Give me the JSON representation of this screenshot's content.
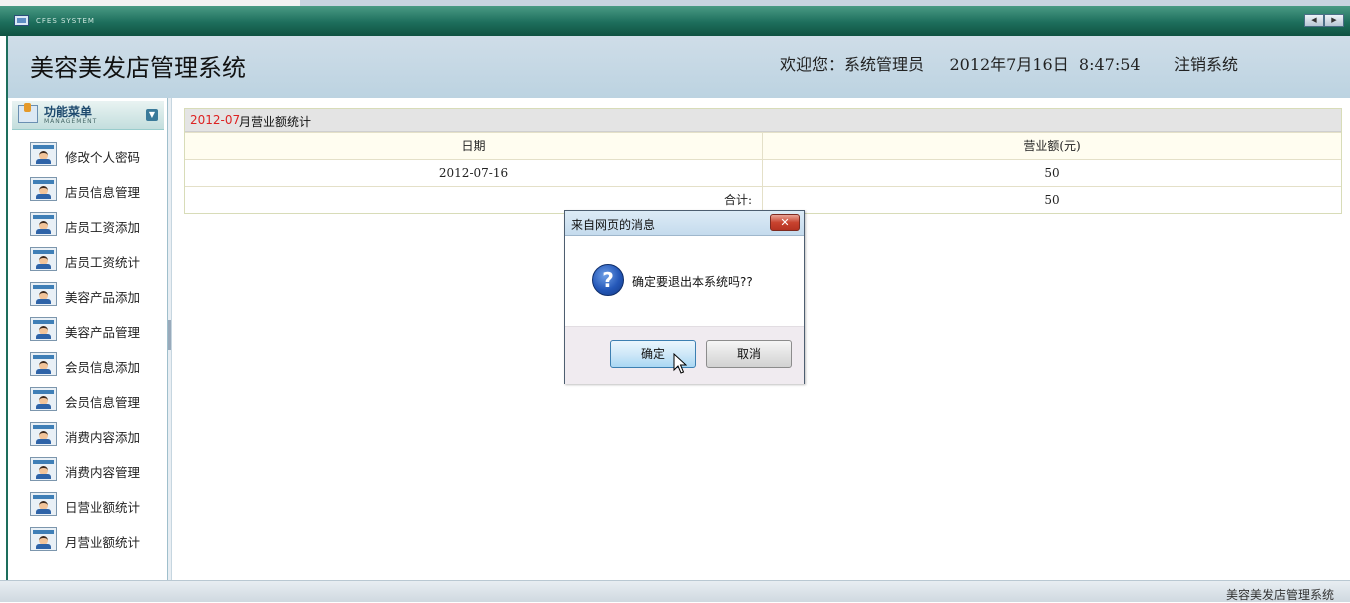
{
  "system_bar": {
    "title": "CFES SYSTEM"
  },
  "header": {
    "app_title": "美容美发店管理系统",
    "welcome": "欢迎您：系统管理员",
    "date": "2012年7月16日",
    "time": "8:47:54",
    "logout": "注销系统"
  },
  "sidebar": {
    "title": "功能菜单",
    "subtitle": "MANAGEMENT",
    "items": [
      {
        "label": "修改个人密码"
      },
      {
        "label": "店员信息管理"
      },
      {
        "label": "店员工资添加"
      },
      {
        "label": "店员工资统计"
      },
      {
        "label": "美容产品添加"
      },
      {
        "label": "美容产品管理"
      },
      {
        "label": "会员信息添加"
      },
      {
        "label": "会员信息管理"
      },
      {
        "label": "消费内容添加"
      },
      {
        "label": "消费内容管理"
      },
      {
        "label": "日营业额统计"
      },
      {
        "label": "月营业额统计"
      }
    ]
  },
  "report": {
    "month": "2012-07",
    "title": "月营业额统计",
    "columns": [
      "日期",
      "营业额(元)"
    ],
    "rows": [
      {
        "date": "2012-07-16",
        "amount": "50"
      }
    ],
    "total_label": "合计:",
    "total_amount": "50"
  },
  "dialog": {
    "title": "来自网页的消息",
    "message": "确定要退出本系统吗??",
    "ok_label": "确定",
    "cancel_label": "取消",
    "icon": "question-icon"
  },
  "footer": {
    "text": "美容美发店管理系统"
  },
  "colors": {
    "header_green": "#1d6e5c",
    "month_red": "#dd2222",
    "header_bg": "#bcd3e1"
  }
}
